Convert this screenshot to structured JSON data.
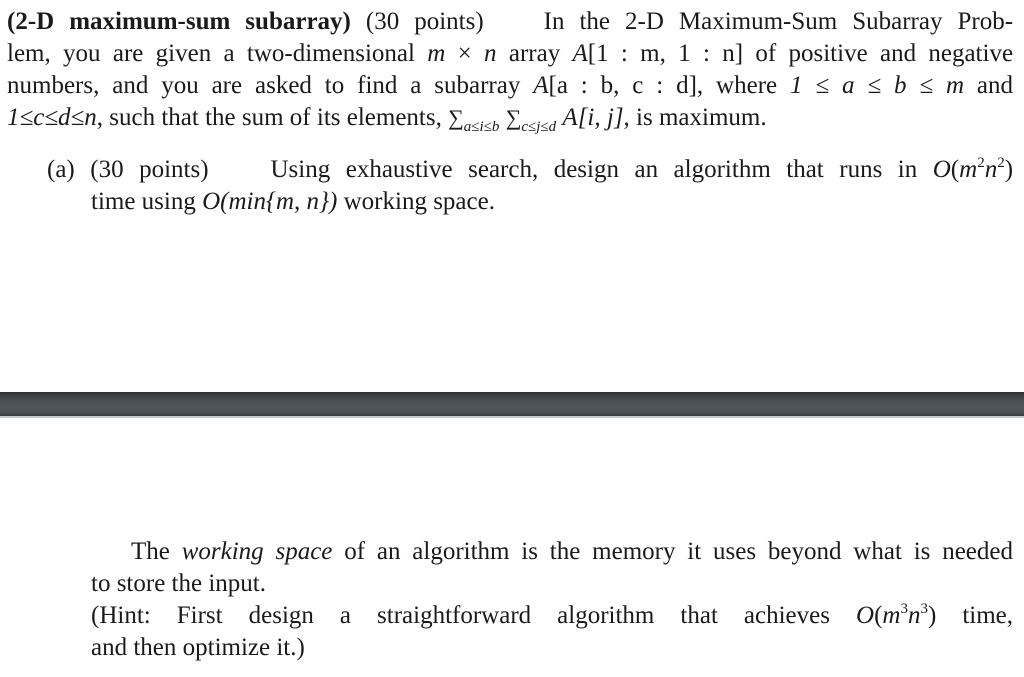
{
  "problem": {
    "title_bold": "(2-D maximum-sum subarray)",
    "points": "(30 points)",
    "line1_rest": "In the 2-D Maximum-Sum Subarray Prob-",
    "line2": {
      "t1": "lem, you are given a two-dimensional",
      "m": "m",
      "times": "×",
      "n": "n",
      "t2": "array",
      "A": "A",
      "idx": "[1 : m, 1 : n]",
      "t3": "of positive and negative"
    },
    "line3": {
      "t1": "numbers, and you are asked to find a subarray",
      "A": "A",
      "idx": "[a : b, c : d]",
      "t2": ", where",
      "cond": "1 ≤ a ≤ b ≤ m",
      "t3": "and"
    },
    "line4": {
      "cond": "1≤c≤d≤n",
      "t1": ", such that the sum of its elements,",
      "sum1": "∑",
      "sub1": "a≤i≤b",
      "sum2": "∑",
      "sub2": "c≤j≤d",
      "expr": "A[i, j]",
      "t2": ", is maximum."
    }
  },
  "part_a": {
    "label": "(a)",
    "points": "(30 points)",
    "line1": {
      "t1": "Using exhaustive search, design an algorithm that runs in",
      "O": "O",
      "open": "(",
      "m": "m",
      "exp_m": "2",
      "n": "n",
      "exp_n": "2",
      "close": ")"
    },
    "line2": {
      "t1": "time using",
      "expr": "O(min{m, n})",
      "t2": "working space."
    }
  },
  "note": {
    "line1": {
      "t1": "The",
      "em": "working space",
      "t2": "of an algorithm is the memory it uses beyond what is needed"
    },
    "line2": "to store the input.",
    "hint_line1": {
      "t1": "(Hint: First design a straightforward algorithm that achieves",
      "O": "O",
      "open": "(",
      "m": "m",
      "exp_m": "3",
      "n": "n",
      "exp_n": "3",
      "close": ")",
      "t2": "time,"
    },
    "hint_line2": "and then optimize it.)"
  }
}
